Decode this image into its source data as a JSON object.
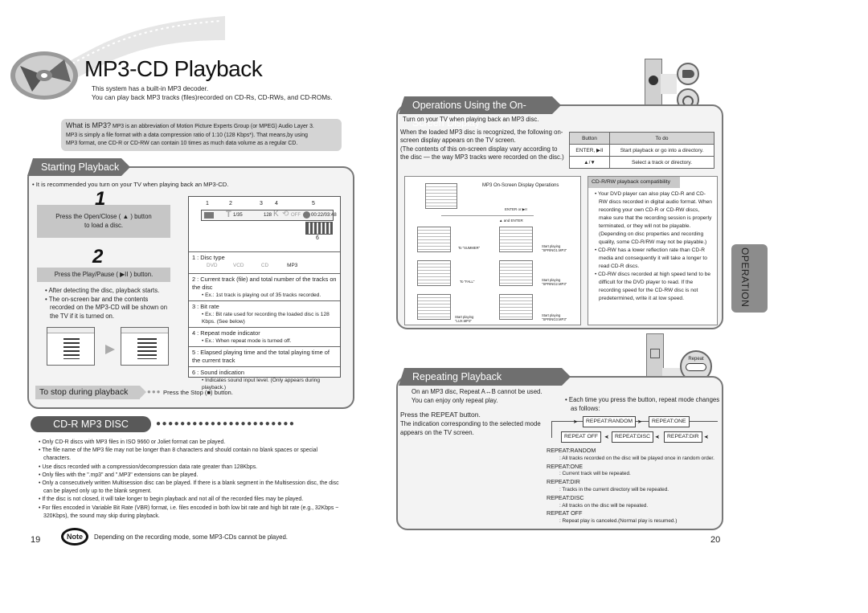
{
  "header": {
    "title": "MP3-CD Playback",
    "intro": [
      "This system has a built-in MP3 decoder.",
      "You can play back MP3 tracks (files)recorded on CD-Rs, CD-RWs, and CD-ROMs."
    ],
    "what_is": {
      "label": "What is MP3?",
      "text1": "MP3 is an abbreviation of Motion Picture Experts Group (or MPEG) Audio Layer 3.",
      "text2": "MP3 is simply a file format with a data compression ratio of 1:10 (128 Kbps*). That means,by using",
      "text3": "MP3 format, one CD-R or CD-RW can contain 10 times as much data volume as a regular CD."
    }
  },
  "starting": {
    "tab": "Starting Playback",
    "tip": "• It is recommended you turn on your TV when playing back an MP3-CD.",
    "step1": {
      "num": "1",
      "text1": "Press the Open/Close ( ▲ ) button",
      "text2": "to load a disc."
    },
    "step2": {
      "num": "2",
      "text": "Press the Play/Pause ( ▶II ) button."
    },
    "notes": [
      "• After detecting the disc, playback starts.",
      "• The on-screen bar and the contents recorded on the MP3-CD will be shown on the TV if it is turned on."
    ],
    "osd_bar": {
      "callouts": [
        "1",
        "2",
        "3",
        "4",
        "5",
        "6"
      ],
      "track": "1/35",
      "bitrate": "128",
      "bitrate_unit": "K",
      "repeat": "OFF",
      "time": "00:22/03:48"
    },
    "legend": [
      {
        "n": "1",
        "title": "Disc type",
        "disc_types": [
          "DVD",
          "VCD",
          "CD",
          "MP3"
        ]
      },
      {
        "n": "2",
        "title": "Current track (file) and total number of the tracks on the disc",
        "sub": "• Ex.: 1st track is playing out of 35 tracks recorded."
      },
      {
        "n": "3",
        "title": "Bit rate",
        "sub": "• Ex.: Bit rate used for recording the loaded disc is 128 Kbps. (See below)"
      },
      {
        "n": "4",
        "title": "Repeat mode indicator",
        "sub": "• Ex.: When repeat mode is turned off."
      },
      {
        "n": "5",
        "title": "Elapsed playing time and the total playing time of the current track"
      },
      {
        "n": "6",
        "title": "Sound indication",
        "sub": "• Indicates sound input level. (Only appears during playback.)"
      }
    ],
    "stop": {
      "label": "To stop during playback",
      "text": "Press the Stop (■) button."
    }
  },
  "cdr": {
    "tab": "CD-R MP3 DISC",
    "bullets": [
      "• Only CD-R discs with MP3 files in ISO 9660 or Joliet format can be played.",
      "• The file name of the MP3 file may not be longer than 8 characters and should contain no blank spaces or special characters.",
      "• Use discs recorded with a compression/decompression data rate greater than 128Kbps.",
      "• Only files with the \".mp3\" and \".MP3\" extensions can be played.",
      "• Only a consecutively written Multisession disc can be played. If there is a blank segment in the Multisession disc, the disc can be played only up to the blank segment.",
      "• If the disc is not closed, it will take longer to begin playback and not all of the recorded files may be played.",
      "• For files encoded in Variable Bit Rate (VBR) format, i.e. files encoded in both low bit rate and high bit rate (e.g., 32Kbps ~ 320Kbps), the sound may skip during playback."
    ]
  },
  "note": {
    "badge": "Note",
    "text": "Depending on the recording mode, some MP3-CDs cannot be played."
  },
  "page_left": "19",
  "page_right": "20",
  "operations": {
    "tab": "Operations Using the On-Screen Display",
    "lead": "Turn on your TV when playing back an MP3 disc.",
    "para1": "When the loaded MP3 disc is recognized, the following on-screen display appears on the TV screen.",
    "para2": "(The contents of this on-screen display vary according to the disc — the way MP3 tracks were recorded on the disc.)",
    "table": {
      "headers": [
        "Button",
        "To do"
      ],
      "rows": [
        [
          "ENTER, ▶II",
          "Start playback or go into a directory."
        ],
        [
          "▲/▼",
          "Select a track or directory."
        ]
      ]
    },
    "diagram": {
      "title": "MP3 On-Screen Display Operations",
      "enter_label": "ENTER or ▶II",
      "up_enter_label": "▲ and ENTER",
      "left_results": [
        "To \"SUMMER\"",
        "To \"FALL\"",
        "Start playing \"LUX.MP3\""
      ],
      "right_results": [
        "Start playing \"SPRING1.MP3\"",
        "Start playing \"SPRING2.MP3\"",
        "Start playing \"SPRING3.MP3\""
      ]
    },
    "compat": {
      "title": "CD-R/RW playback compatibility",
      "bullets": [
        "• Your DVD player can also play CD-R and CD-RW discs recorded in digital audio format. When recording your own CD-R or CD-RW discs, make sure that the recording session is properly terminated, or they will not be playable. (Depending on disc properties and recording quality, some CD-R/RW may not be playable.)",
        "• CD-RW has a lower reflection rate than CD-R media and consequently it will take a longer to read CD-R discs.",
        "• CD-RW discs recorded at high speed tend to be difficult for the DVD player to read. If the recording speed for the CD-RW disc is not predetermined, write it at low speed."
      ]
    }
  },
  "side_tab": "OPERATION",
  "repeating": {
    "tab": "Repeating Playback",
    "intro1": "On an MP3 disc, Repeat A↔B cannot be used.",
    "intro2": "You can enjoy only repeat play.",
    "press": "Press the REPEAT button.",
    "indication": "The indication corresponding to the selected mode appears on the TV screen.",
    "each_time": "• Each time you press the button, repeat mode changes as follows:",
    "callout_label": "Repeat",
    "cycle": [
      "REPEAT:RANDOM",
      "REPEAT:ONE",
      "REPEAT:DIR",
      "REPEAT:DISC",
      "REPEAT OFF"
    ],
    "descriptions": [
      {
        "mode": "REPEAT:RANDOM",
        "desc": ": All tracks recorded on the disc will be played once in random order."
      },
      {
        "mode": "REPEAT:ONE",
        "desc": ": Current track will be repeated."
      },
      {
        "mode": "REPEAT:DIR",
        "desc": ": Tracks in the current directory will be repeated."
      },
      {
        "mode": "REPEAT:DISC",
        "desc": ": All tracks on the disc will be repeated."
      },
      {
        "mode": "REPEAT OFF",
        "desc": ": Repeat play is canceled.(Normal play is resumed.)"
      }
    ]
  }
}
